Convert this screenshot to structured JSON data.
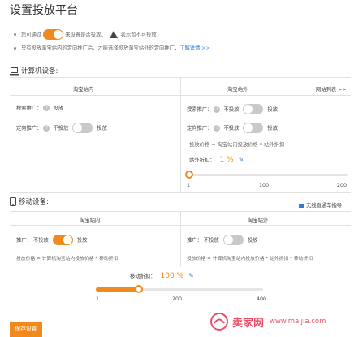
{
  "page": {
    "title": "设置投放平台"
  },
  "notes": {
    "line1_prefix": "您可通过",
    "line1_mid": "来设置是否投放，",
    "line1_suffix": "表示暂不可投放",
    "line2_text": "只有投放淘宝站内的定向推广后，才能选择投放淘宝站外的定向推广",
    "line2_link": "了解详情 >>"
  },
  "computer": {
    "section_title": "计算机设备:",
    "left_col_header": "淘宝站内",
    "right_col_header": "淘宝站外",
    "site_list_link": "网站列表 >>",
    "left_row1_label": "搜索推广：",
    "left_row1_value": "投放",
    "left_row2_label": "定向推广：",
    "left_row2_off": "不投放",
    "left_row2_on": "投放",
    "right_row1_label": "搜索推广：",
    "right_row1_off": "不投放",
    "right_row1_on": "投放",
    "right_row2_label": "定向推广：",
    "right_row2_off": "不投放",
    "right_row2_on": "投放",
    "formula": "投放价格 = 淘宝站内投放价格 * 站外折扣",
    "discount_label": "站外折扣：",
    "discount_value": "1 %",
    "slider_ticks": [
      "1",
      "100",
      "200"
    ],
    "slider_level_percent": 1
  },
  "mobile": {
    "section_title": "移动设备:",
    "guide_link": "无线直通车指导",
    "left_col_header": "淘宝站内",
    "right_col_header": "淘宝站外",
    "left_label": "推广：",
    "left_off": "不投放",
    "left_on": "投放",
    "right_label": "推广：",
    "right_off": "不投放",
    "right_on": "投放",
    "left_formula": "投放价格 = 计算机淘宝站内投放价格 * 移动折扣",
    "right_formula": "投放价格 = 计算机淘宝站内投放价格 * 站外折扣 * 移动折扣",
    "discount_label": "移动折扣：",
    "discount_value": "100 %",
    "slider_ticks": [
      "1",
      "200",
      "400"
    ],
    "slider_level_percent": 100
  },
  "footer": {
    "save_label": "保存设置"
  },
  "watermark": {
    "brand": "卖家网",
    "url": "www.maijia.com"
  },
  "colors": {
    "accent": "#f08a1c",
    "link": "#2d7fd8",
    "toggle_off": "#c9c9c9"
  }
}
